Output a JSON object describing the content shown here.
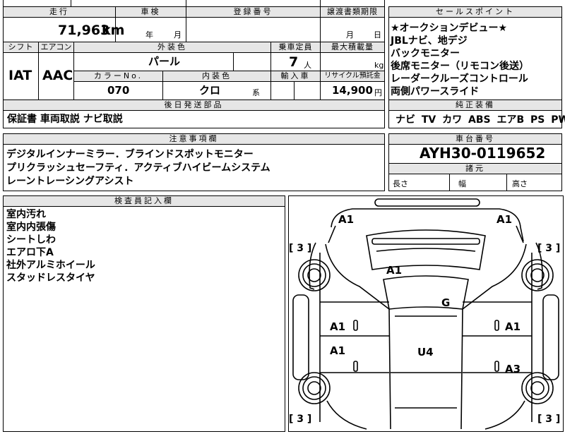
{
  "mileage": {
    "header": "走行",
    "value": "71,963",
    "unit": "km"
  },
  "inspection": {
    "header": "車検",
    "year_unit": "年",
    "month_unit": "月"
  },
  "registration": {
    "header": "登録番号"
  },
  "transfer": {
    "header": "譲渡書類期限",
    "month_unit": "月",
    "day_unit": "日"
  },
  "shift": {
    "header": "シフト",
    "value": "IAT"
  },
  "aircon": {
    "header": "エアコン",
    "value": "AAC"
  },
  "exterior_color": {
    "header": "外装色",
    "value": "パール"
  },
  "capacity": {
    "header": "乗車定員",
    "value": "7",
    "unit": "人"
  },
  "max_load": {
    "header": "最大積載量",
    "unit": "kg"
  },
  "color_no": {
    "header": "カラーNo.",
    "value": "070"
  },
  "interior_color": {
    "header": "内装色",
    "value": "クロ",
    "suffix": "系"
  },
  "import": {
    "header": "輸入車"
  },
  "recycle": {
    "header": "リサイクル預託金",
    "value": "14,900",
    "unit": "円"
  },
  "later_parts": {
    "header": "後日発送部品",
    "value": "保証書 車両取説 ナビ取説"
  },
  "notes": {
    "header": "注意事項欄",
    "lines": [
      "デジタルインナーミラー．ブラインドスポットモニター",
      "プリクラッシュセーフティ．アクティブハイビームシステム",
      "レーントレーシングアシスト"
    ]
  },
  "sales_points": {
    "header": "セールスポイント",
    "lines": [
      "★オークションデビュー★",
      "JBLナビ、地デジ",
      "バックモニター",
      "後席モニター（リモコン後送）",
      "レーダークルーズコントロール",
      "両側パワースライド"
    ]
  },
  "equipment": {
    "header": "純正装備",
    "value": "ナビ TV カワ ABS エアB PS PW"
  },
  "chassis": {
    "header": "車台番号",
    "value": "AYH30-0119652"
  },
  "specs": {
    "header": "諸元",
    "length": "長さ",
    "width": "幅",
    "height": "高さ"
  },
  "inspector": {
    "header": "検査員記入欄",
    "lines": [
      "室内汚れ",
      "室内内張傷",
      "シートしわ",
      "エアロ下A",
      "社外アルミホイール",
      "スタッドレスタイヤ"
    ]
  },
  "diagram": {
    "marks": {
      "front_left": "A1",
      "front_right": "A1",
      "hood": "A1",
      "glass": "G",
      "left_front_door": "A1",
      "right_front_door": "A1",
      "left_rear_door": "A1",
      "right_rear_door": "A3",
      "roof": "U4"
    },
    "tire_marks": [
      "[ 3 ]",
      "[ 3 ]",
      "[ 3 ]",
      "[ 3 ]"
    ]
  }
}
